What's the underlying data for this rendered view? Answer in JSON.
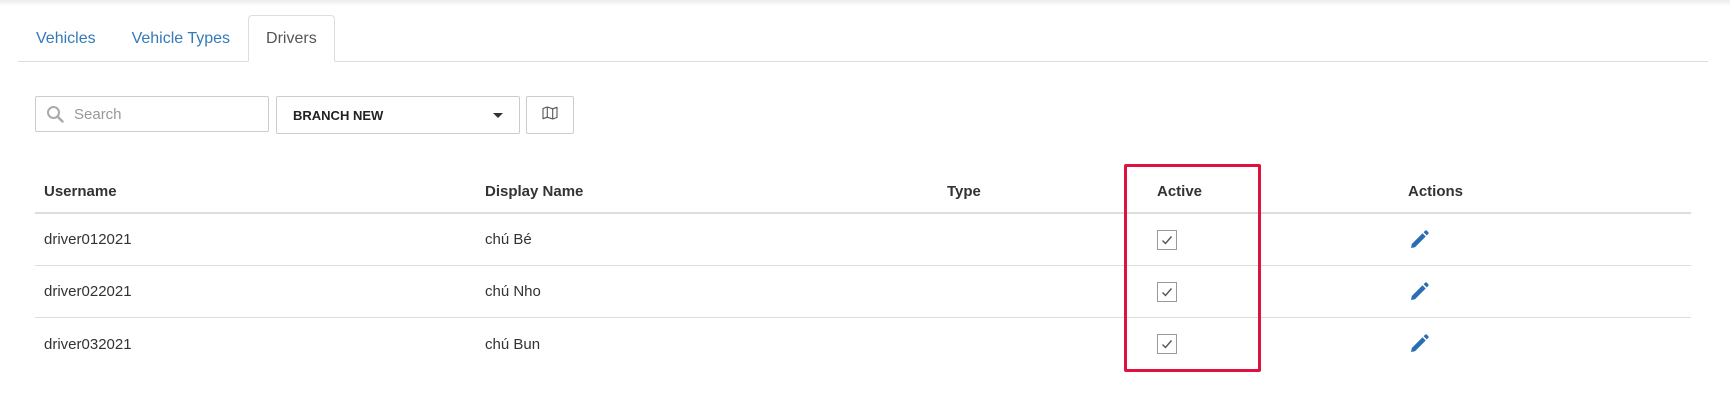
{
  "tabs": [
    {
      "label": "Vehicles",
      "active": false
    },
    {
      "label": "Vehicle Types",
      "active": false
    },
    {
      "label": "Drivers",
      "active": true
    }
  ],
  "toolbar": {
    "search_placeholder": "Search",
    "search_value": "",
    "branch_selected": "BRANCH NEW",
    "map_icon": "map-icon"
  },
  "table": {
    "columns": [
      "Username",
      "Display Name",
      "Type",
      "Active",
      "Actions"
    ],
    "rows": [
      {
        "username": "driver012021",
        "display_name": "chú Bé",
        "type": "",
        "active": true
      },
      {
        "username": "driver022021",
        "display_name": "chú Nho",
        "type": "",
        "active": true
      },
      {
        "username": "driver032021",
        "display_name": "chú Bun",
        "type": "",
        "active": true
      }
    ]
  },
  "colors": {
    "link": "#337ab7",
    "highlight": "#e0103f",
    "edit_icon": "#2a6db3"
  },
  "icons": {
    "search": "search-icon",
    "caret": "chevron-down-icon",
    "edit": "pencil-icon",
    "check": "check-icon"
  }
}
